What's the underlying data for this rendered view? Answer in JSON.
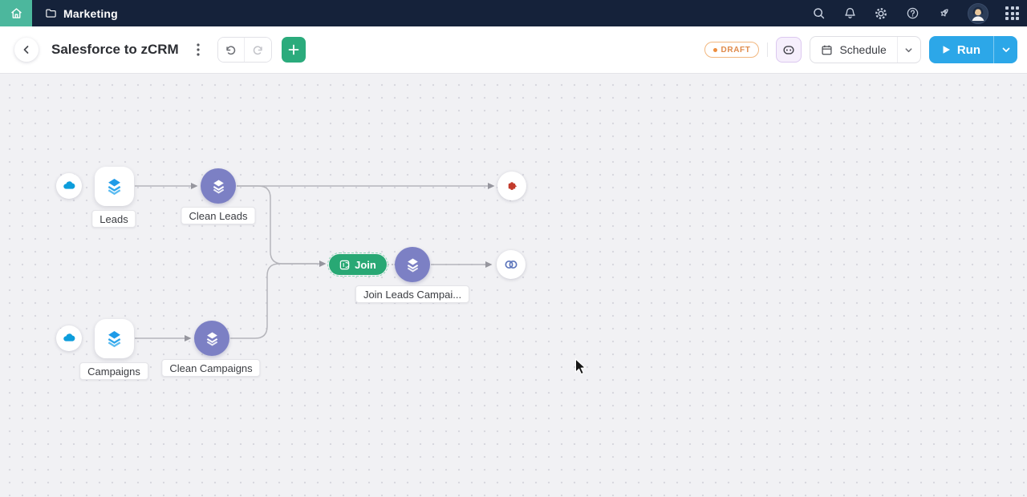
{
  "colors": {
    "topbar_bg": "#15223a",
    "home_accent": "#4cb79d",
    "primary_green": "#2bab7c",
    "run_blue": "#2ca7e8",
    "node_purple": "#7c80c4",
    "draft_orange": "#ed8d3d",
    "salesforce_blue": "#0d9ddb",
    "dataset_blue": "#1f9be8",
    "crm_ring_blue": "#5b74bb",
    "marketing_red": "#c23a2b",
    "edge_gray": "#b5b5bb"
  },
  "topbar": {
    "project_label": "Marketing",
    "icons": [
      "home",
      "folder",
      "search",
      "notifications",
      "settings",
      "help",
      "whats-new",
      "avatar",
      "apps"
    ]
  },
  "toolbar": {
    "title": "Salesforce to zCRM",
    "status_badge": "DRAFT",
    "schedule_label": "Schedule",
    "run_label": "Run"
  },
  "canvas": {
    "nodes": [
      {
        "id": "salesforce-leads-source",
        "type": "connector",
        "icon": "salesforce-icon",
        "label": ""
      },
      {
        "id": "leads-dataset",
        "type": "dataset",
        "icon": "layers-icon",
        "label": "Leads"
      },
      {
        "id": "clean-leads-stage",
        "type": "transform",
        "icon": "layers-icon",
        "label": "Clean Leads"
      },
      {
        "id": "marketing-automation-destination",
        "type": "destination",
        "icon": "zoho-marketing-automation-icon",
        "label": ""
      },
      {
        "id": "join-operation",
        "type": "join",
        "icon": "join-icon",
        "label": "Join"
      },
      {
        "id": "join-leads-campaigns-stage",
        "type": "transform",
        "icon": "layers-icon",
        "label": "Join Leads Campai..."
      },
      {
        "id": "zoho-crm-destination",
        "type": "destination",
        "icon": "zoho-crm-icon",
        "label": ""
      },
      {
        "id": "salesforce-campaigns-source",
        "type": "connector",
        "icon": "salesforce-icon",
        "label": ""
      },
      {
        "id": "campaigns-dataset",
        "type": "dataset",
        "icon": "layers-icon",
        "label": "Campaigns"
      },
      {
        "id": "clean-campaigns-stage",
        "type": "transform",
        "icon": "layers-icon",
        "label": "Clean Campaigns"
      }
    ],
    "edges": [
      {
        "from": "leads-dataset",
        "to": "clean-leads-stage"
      },
      {
        "from": "clean-leads-stage",
        "to": "marketing-automation-destination"
      },
      {
        "from": "clean-leads-stage",
        "to": "join-operation"
      },
      {
        "from": "clean-campaigns-stage",
        "to": "join-operation"
      },
      {
        "from": "join-operation",
        "to": "join-leads-campaigns-stage"
      },
      {
        "from": "join-leads-campaigns-stage",
        "to": "zoho-crm-destination"
      },
      {
        "from": "campaigns-dataset",
        "to": "clean-campaigns-stage"
      }
    ]
  }
}
